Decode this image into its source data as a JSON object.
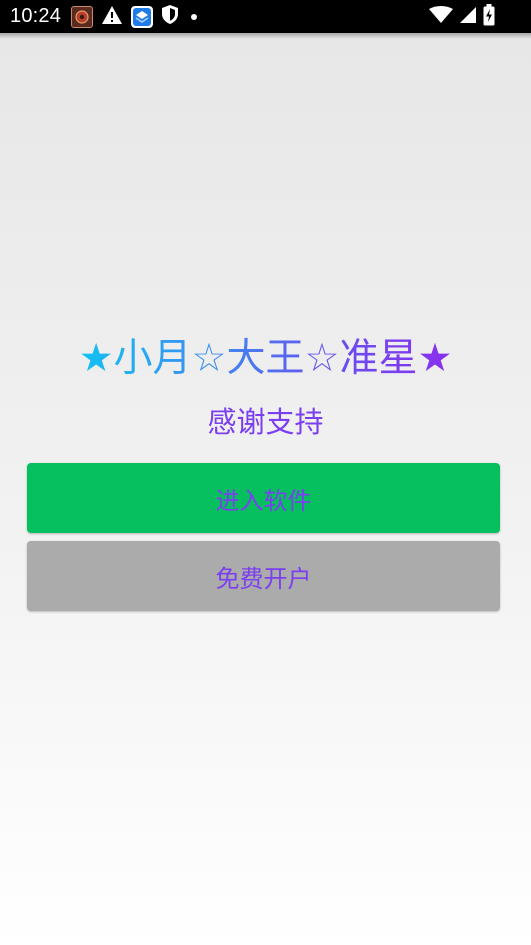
{
  "status_bar": {
    "time": "10:24",
    "icons_left": [
      "app-notification-icon",
      "warning-icon",
      "layers-app-icon",
      "shield-icon",
      "dot"
    ],
    "icons_right": [
      "wifi-icon",
      "cellular-signal-icon",
      "battery-charging-icon"
    ]
  },
  "main": {
    "title": "★小月☆大王☆准星★",
    "subtitle": "感谢支持",
    "enter_button_label": "进入软件",
    "open_account_button_label": "免费开户"
  },
  "colors": {
    "title_gradient_start": "#12c2f3",
    "title_gradient_end": "#8b2ff0",
    "text_purple": "#7b3ef0",
    "enter_button_bg": "#06c05f",
    "open_account_button_bg": "#ababab",
    "status_bar_bg": "#000000"
  }
}
